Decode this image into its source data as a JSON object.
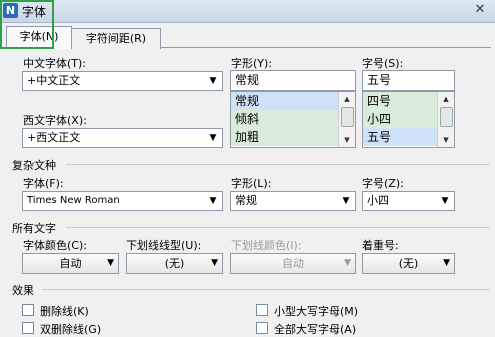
{
  "window": {
    "title": "字体",
    "app_icon": "N",
    "close_glyph": "✕"
  },
  "tabs": [
    {
      "label": "字体(N)"
    },
    {
      "label": "字符间距(R)"
    }
  ],
  "font": {
    "chinese_label": "中文字体(T):",
    "chinese_value": "+中文正文",
    "western_label": "西文字体(X):",
    "western_value": "+西文正文",
    "style_label": "字形(Y):",
    "style_value": "常规",
    "style_options": [
      "常规",
      "倾斜",
      "加粗"
    ],
    "size_label": "字号(S):",
    "size_value": "五号",
    "size_options": [
      "四号",
      "小四",
      "五号"
    ]
  },
  "complex": {
    "group_title": "复杂文种",
    "font_label": "字体(F):",
    "font_value": "Times New Roman",
    "style_label": "字形(L):",
    "style_value": "常规",
    "size_label": "字号(Z):",
    "size_value": "小四"
  },
  "all_text": {
    "group_title": "所有文字",
    "color_label": "字体颜色(C):",
    "color_value": "自动",
    "underline_label": "下划线线型(U):",
    "underline_value": "(无)",
    "underline_color_label": "下划线颜色(I):",
    "underline_color_value": "自动",
    "emphasis_label": "着重号:",
    "emphasis_value": "(无)"
  },
  "effects": {
    "group_title": "效果",
    "strikethrough": "删除线(K)",
    "double_strikethrough": "双删除线(G)",
    "small_caps": "小型大写字母(M)",
    "all_caps": "全部大写字母(A)"
  },
  "colors": {
    "highlight_green": "#2aa14a",
    "list_bg": "#d9ecd9",
    "list_selected": "#cfe1f7"
  }
}
